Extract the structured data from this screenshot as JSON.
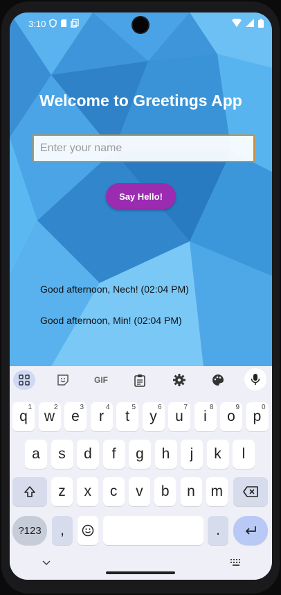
{
  "statusbar": {
    "time": "3:10"
  },
  "app": {
    "title": "Welcome to Greetings App",
    "name_placeholder": "Enter your name",
    "name_value": "",
    "say_hello_label": "Say Hello!",
    "greetings": [
      "Good afternoon, Nech! (02:04 PM)",
      "Good afternoon, Min! (02:04 PM)"
    ]
  },
  "keyboard": {
    "toolbar": [
      "apps-icon",
      "sticker-icon",
      "GIF",
      "clipboard-icon",
      "gear-icon",
      "palette-icon",
      "microphone-icon"
    ],
    "row1": [
      {
        "k": "q",
        "h": "1"
      },
      {
        "k": "w",
        "h": "2"
      },
      {
        "k": "e",
        "h": "3"
      },
      {
        "k": "r",
        "h": "4"
      },
      {
        "k": "t",
        "h": "5"
      },
      {
        "k": "y",
        "h": "6"
      },
      {
        "k": "u",
        "h": "7"
      },
      {
        "k": "i",
        "h": "8"
      },
      {
        "k": "o",
        "h": "9"
      },
      {
        "k": "p",
        "h": "0"
      }
    ],
    "row2": [
      "a",
      "s",
      "d",
      "f",
      "g",
      "h",
      "j",
      "k",
      "l"
    ],
    "row3": [
      "z",
      "x",
      "c",
      "v",
      "b",
      "n",
      "m"
    ],
    "symbols_label": "?123",
    "comma": ",",
    "period": "."
  }
}
